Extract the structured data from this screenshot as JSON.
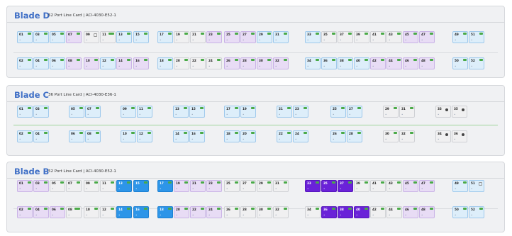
{
  "colors": {
    "accent": "#3f6fc6",
    "active_blue": "#2d95e8",
    "active_purple": "#6a22d8",
    "link_green": "#4aaa48"
  },
  "blades": [
    {
      "title": "Blade D",
      "subtitle": "52 Port Line Card  |  ACI-4030-E52-1",
      "top": [
        [
          "01",
          "lightblue",
          "g"
        ],
        [
          "03",
          "lightblue",
          "g"
        ],
        [
          "05",
          "lightblue",
          "g"
        ],
        [
          "07",
          "lavender",
          "g"
        ],
        [
          "09",
          "gray",
          "sq"
        ],
        [
          "11",
          "gray",
          "gbig"
        ],
        [
          "13",
          "lightblue",
          "g"
        ],
        [
          "15",
          "lightblue",
          "g"
        ],
        [
          "17",
          "lightblue",
          "g"
        ],
        [
          "19",
          "gray",
          "g"
        ],
        [
          "21",
          "gray",
          "g"
        ],
        [
          "23",
          "lavender",
          "g"
        ],
        [
          "25",
          "lavender",
          "g"
        ],
        [
          "27",
          "lavender",
          "g"
        ],
        [
          "29",
          "lightblue",
          "g"
        ],
        [
          "31",
          "lightblue",
          "g"
        ],
        [
          "33",
          "lightblue",
          "g"
        ],
        [
          "35",
          "gray",
          "g"
        ],
        [
          "37",
          "gray",
          "g"
        ],
        [
          "39",
          "gray",
          "g"
        ],
        [
          "41",
          "gray",
          "g"
        ],
        [
          "43",
          "gray",
          "g"
        ],
        [
          "45",
          "lavender",
          "g"
        ],
        [
          "47",
          "lavender",
          "g"
        ],
        [
          "49",
          "lightblue",
          "g"
        ],
        [
          "51",
          "lightblue",
          "g"
        ]
      ],
      "bottom": [
        [
          "02",
          "lightblue",
          "g"
        ],
        [
          "04",
          "lightblue",
          "g"
        ],
        [
          "06",
          "lightblue",
          "g"
        ],
        [
          "08",
          "lavender",
          "g"
        ],
        [
          "10",
          "lavender",
          "g"
        ],
        [
          "12",
          "lightblue",
          "g"
        ],
        [
          "14",
          "lavender",
          "g"
        ],
        [
          "16",
          "lavender",
          "g"
        ],
        [
          "18",
          "lightblue",
          "g"
        ],
        [
          "20",
          "gray",
          "g"
        ],
        [
          "22",
          "gray",
          "g"
        ],
        [
          "24",
          "gray",
          "g"
        ],
        [
          "26",
          "lavender",
          "g"
        ],
        [
          "28",
          "lavender",
          "g"
        ],
        [
          "30",
          "lavender",
          "g"
        ],
        [
          "32",
          "lavender",
          "g"
        ],
        [
          "34",
          "lightblue",
          "g"
        ],
        [
          "36",
          "lightblue",
          "g"
        ],
        [
          "38",
          "lightblue",
          "g"
        ],
        [
          "40",
          "lightblue",
          "g"
        ],
        [
          "42",
          "lavender",
          "g"
        ],
        [
          "44",
          "lavender",
          "g"
        ],
        [
          "46",
          "lavender",
          "g"
        ],
        [
          "48",
          "lavender",
          "g"
        ],
        [
          "50",
          "lightblue",
          "g"
        ],
        [
          "52",
          "lightblue",
          "g"
        ]
      ]
    },
    {
      "title": "Blade C",
      "subtitle": "36 Port Line Card  |  ACI-4030-E36-1",
      "top": [
        [
          "01",
          "lightblue",
          "g"
        ],
        [
          "03",
          "lightblue",
          "g"
        ],
        [
          "05",
          "lightblue",
          "g"
        ],
        [
          "07",
          "lightblue",
          "g"
        ],
        [
          "09",
          "lightblue",
          "g"
        ],
        [
          "11",
          "lightblue",
          "g"
        ],
        [
          "13",
          "lightblue",
          "g"
        ],
        [
          "15",
          "lightblue",
          "g"
        ],
        [
          "17",
          "lightblue",
          "g"
        ],
        [
          "19",
          "lightblue",
          "g"
        ],
        [
          "21",
          "lightblue",
          "g"
        ],
        [
          "23",
          "lightblue",
          "g"
        ],
        [
          "25",
          "lightblue",
          "g"
        ],
        [
          "27",
          "lightblue",
          "g"
        ],
        [
          "29",
          "gray",
          "g"
        ],
        [
          "31",
          "gray",
          "g"
        ],
        [
          "33",
          "gray",
          "dot"
        ],
        [
          "35",
          "gray",
          "dot"
        ]
      ],
      "bottom": [
        [
          "02",
          "lightblue",
          "g"
        ],
        [
          "04",
          "lightblue",
          "g"
        ],
        [
          "06",
          "lightblue",
          "g"
        ],
        [
          "08",
          "lightblue",
          "g"
        ],
        [
          "10",
          "lightblue",
          "g"
        ],
        [
          "12",
          "lightblue",
          "g"
        ],
        [
          "14",
          "lightblue",
          "g"
        ],
        [
          "16",
          "lightblue",
          "g"
        ],
        [
          "18",
          "lightblue",
          "g"
        ],
        [
          "20",
          "lightblue",
          "g"
        ],
        [
          "22",
          "lightblue",
          "g"
        ],
        [
          "24",
          "lightblue",
          "g"
        ],
        [
          "26",
          "lightblue",
          "g"
        ],
        [
          "28",
          "lightblue",
          "g"
        ],
        [
          "30",
          "gray",
          "g"
        ],
        [
          "32",
          "gray",
          "g"
        ],
        [
          "34",
          "gray",
          "dot"
        ],
        [
          "36",
          "gray",
          "dot"
        ]
      ]
    },
    {
      "title": "Blade B",
      "subtitle": "52 Port Line Card  |  ACI-4030-E52-1",
      "top": [
        [
          "01",
          "lavender",
          "g"
        ],
        [
          "03",
          "lavender",
          "g"
        ],
        [
          "05",
          "gray",
          "g"
        ],
        [
          "07",
          "gray",
          "g"
        ],
        [
          "09",
          "gray",
          "g"
        ],
        [
          "11",
          "gray",
          "g"
        ],
        [
          "13",
          "blue",
          "g"
        ],
        [
          "15",
          "blue",
          "g"
        ],
        [
          "17",
          "blue",
          "g"
        ],
        [
          "19",
          "lavender",
          "g"
        ],
        [
          "21",
          "lavender",
          "g"
        ],
        [
          "23",
          "lavender",
          "g"
        ],
        [
          "25",
          "gray",
          "g"
        ],
        [
          "27",
          "gray",
          "g"
        ],
        [
          "29",
          "gray",
          "g"
        ],
        [
          "31",
          "gray",
          "g"
        ],
        [
          "33",
          "purple",
          "g"
        ],
        [
          "35",
          "purple",
          "g"
        ],
        [
          "37",
          "purple",
          "g"
        ],
        [
          "39",
          "gray",
          "g"
        ],
        [
          "41",
          "gray",
          "g"
        ],
        [
          "43",
          "gray",
          "g"
        ],
        [
          "45",
          "lavender",
          "g"
        ],
        [
          "47",
          "lavender",
          "g"
        ],
        [
          "49",
          "lightblue",
          "g"
        ],
        [
          "51",
          "lightblue",
          "sq"
        ]
      ],
      "bottom": [
        [
          "02",
          "lavender",
          "g"
        ],
        [
          "04",
          "lavender",
          "g"
        ],
        [
          "06",
          "lavender",
          "g"
        ],
        [
          "08",
          "gray",
          "gbig"
        ],
        [
          "10",
          "gray",
          "g"
        ],
        [
          "12",
          "gray",
          "g"
        ],
        [
          "14",
          "blue",
          "g"
        ],
        [
          "16",
          "blue",
          "g"
        ],
        [
          "18",
          "blue",
          "g"
        ],
        [
          "20",
          "lavender",
          "g"
        ],
        [
          "22",
          "lavender",
          "g"
        ],
        [
          "24",
          "lavender",
          "g"
        ],
        [
          "26",
          "gray",
          "g"
        ],
        [
          "28",
          "gray",
          "g"
        ],
        [
          "30",
          "gray",
          "g"
        ],
        [
          "32",
          "gray",
          "g"
        ],
        [
          "34",
          "gray",
          "g"
        ],
        [
          "36",
          "purple",
          "g"
        ],
        [
          "38",
          "purple",
          "g"
        ],
        [
          "40",
          "purple",
          "g"
        ],
        [
          "42",
          "gray",
          "g"
        ],
        [
          "44",
          "gray",
          "g"
        ],
        [
          "46",
          "lavender",
          "g"
        ],
        [
          "48",
          "lavender",
          "g"
        ],
        [
          "50",
          "lightblue",
          "g"
        ],
        [
          "52",
          "lightblue",
          "g"
        ]
      ]
    }
  ]
}
